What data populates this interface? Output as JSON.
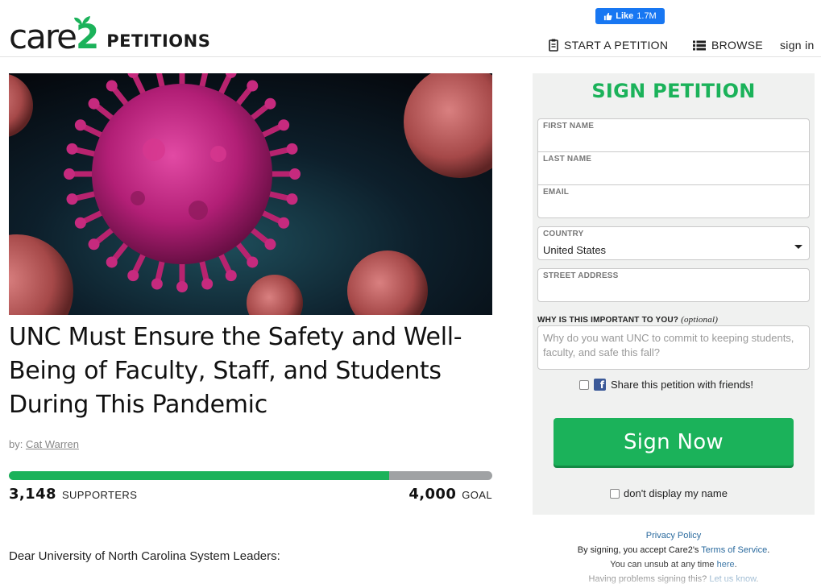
{
  "header": {
    "logo_main": "care",
    "logo_accent": "2",
    "logo_section": "PETITIONS",
    "fb_like_label": "Like",
    "fb_like_count": "1.7M",
    "nav": {
      "start_petition": "START A PETITION",
      "browse": "BROWSE",
      "sign_in": "sign in"
    }
  },
  "petition": {
    "title": "UNC Must Ensure the Safety and Well-Being of Faculty, Staff, and Students During This Pandemic",
    "byline_prefix": "by:",
    "author": "Cat Warren",
    "supporters_count": "3,148",
    "supporters_label": "SUPPORTERS",
    "goal_count": "4,000",
    "goal_label": "GOAL",
    "progress_fraction": 0.787,
    "letter_opening": "Dear University of North Carolina System Leaders:"
  },
  "sign_form": {
    "title": "SIGN PETITION",
    "first_name_label": "FIRST NAME",
    "last_name_label": "LAST NAME",
    "email_label": "EMAIL",
    "country_label": "COUNTRY",
    "country_value": "United States",
    "street_label": "STREET ADDRESS",
    "why_label": "WHY IS THIS IMPORTANT TO YOU?",
    "why_optional": "(optional)",
    "why_placeholder": "Why do you want UNC to commit to keeping students, faculty, and safe this fall?",
    "share_label": "Share this petition with friends!",
    "sign_button": "Sign Now",
    "anonymous_label": "don't display my name"
  },
  "legal": {
    "privacy_policy": "Privacy Policy",
    "tos_prefix": "By signing, you accept Care2's",
    "tos_link": "Terms of Service",
    "unsub_prefix": "You can unsub at any time",
    "unsub_link": "here",
    "problems_prefix": "Having problems signing this?",
    "problems_link": "Let us know"
  },
  "colors": {
    "brand_green": "#1bb25a",
    "progress_track": "#a0a2a4",
    "link_blue": "#2a6a9e",
    "facebook_blue": "#1877f2"
  }
}
